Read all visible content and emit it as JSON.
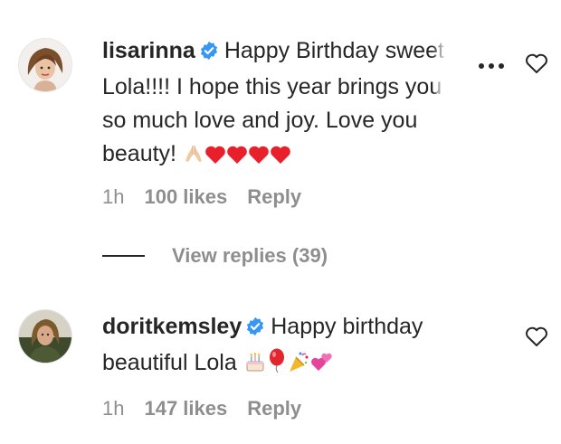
{
  "comments": [
    {
      "username": "lisarinna",
      "text_line1": "Happy Birthday swe",
      "text_fade1": "et",
      "text_line2": "Lola!!!! I hope this year brings yo",
      "text_fade2": "u",
      "text_line3": "so much love and joy. Love you",
      "text_line4": "beauty!",
      "emojis": "folded-hands, four red hearts",
      "time": "1h",
      "likes": "100 likes",
      "reply": "Reply"
    },
    {
      "username": "doritkemsley",
      "text_line1": "Happy birthday",
      "text_line2": "beautiful Lola",
      "emojis": "birthday-cake, balloon, party-popper, two-hearts",
      "time": "1h",
      "likes": "147 likes",
      "reply": "Reply"
    }
  ],
  "view_replies": "View replies (39)",
  "icons": {
    "verified": "verified-badge-icon",
    "more": "more-options-icon",
    "like": "heart-outline-icon"
  },
  "colors": {
    "text": "#262626",
    "muted": "#8e8e8e",
    "verified": "#3897f0",
    "heart": "#e8202b"
  }
}
